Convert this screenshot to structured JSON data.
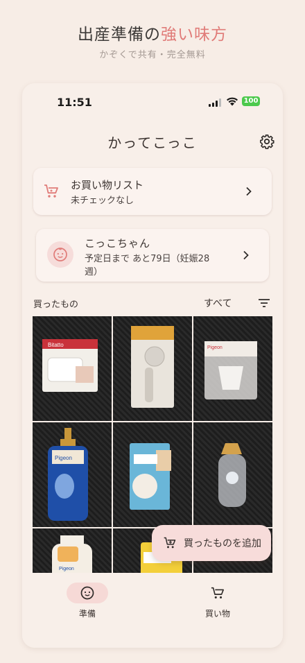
{
  "hero": {
    "title_main": "出産準備の",
    "title_accent": "強い味方",
    "subtitle": "かぞくで共有・完全無料"
  },
  "status": {
    "time": "11:51",
    "battery": "100"
  },
  "app": {
    "title": "かってこっこ"
  },
  "shopping_card": {
    "title": "お買い物リスト",
    "subtitle": "未チェックなし"
  },
  "baby_card": {
    "name": "こっこちゃん",
    "due_line1": "予定日まで あと79日（妊娠28",
    "due_line2": "週）"
  },
  "section": {
    "label": "買ったもの",
    "filter_label": "すべて"
  },
  "fab": {
    "label": "買ったものを追加"
  },
  "nav": {
    "items": [
      {
        "label": "準備",
        "icon": "baby-face-icon",
        "active": true
      },
      {
        "label": "買い物",
        "icon": "cart-icon",
        "active": false
      }
    ]
  },
  "colors": {
    "accent": "#e07b78",
    "background": "#f7ede6",
    "card": "#fbf3ef",
    "pill": "#f6d9d6",
    "battery": "#4cc94c"
  },
  "photos": {
    "tile_text": [
      "Bitatto",
      "Pigeon",
      "Pigeon",
      "Pigeon"
    ]
  }
}
